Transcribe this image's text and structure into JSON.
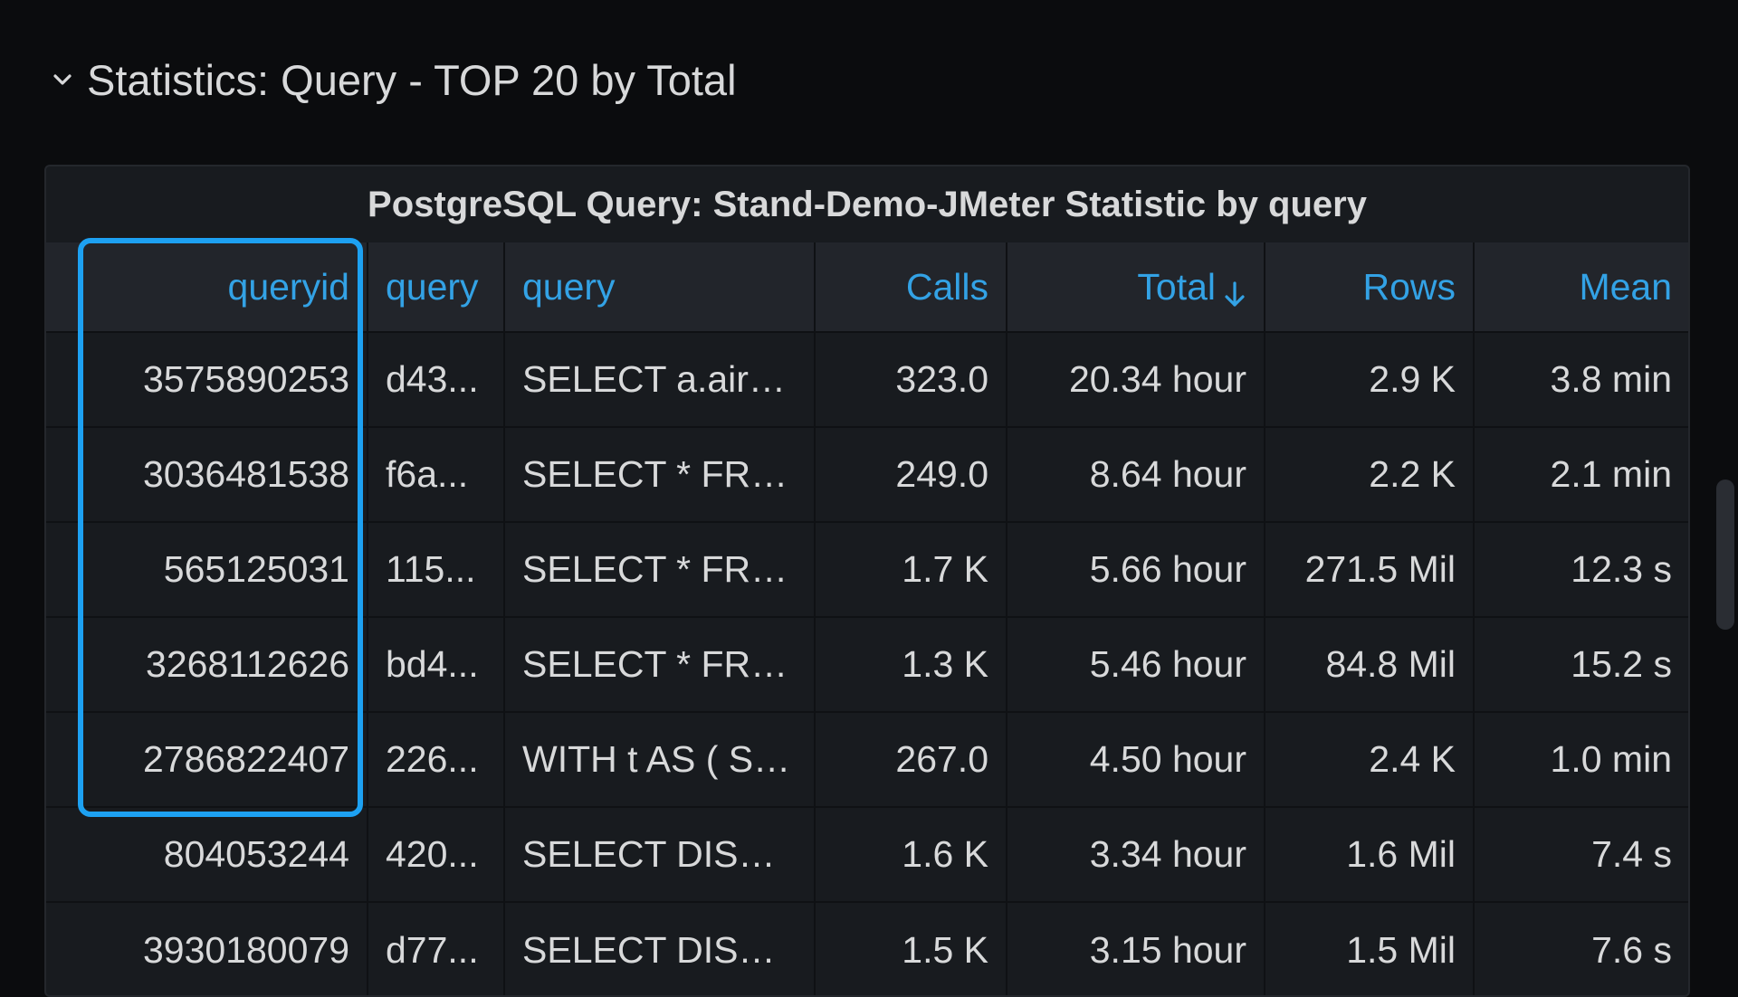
{
  "row": {
    "title": "Statistics: Query - TOP 20 by Total",
    "icon": "chevron-down-icon"
  },
  "panel": {
    "title": "PostgreSQL Query: Stand-Demo-JMeter Statistic by query"
  },
  "table": {
    "columns": [
      "queryid",
      "query",
      "query",
      "Calls",
      "Total",
      "Rows",
      "Mean"
    ],
    "sorted_column": "Total",
    "sort_direction": "descending",
    "rows": [
      {
        "queryid": "3575890253",
        "query_hash": "d43...",
        "query": "SELECT a.aircr...",
        "calls": "323.0",
        "total": "20.34 hour",
        "rows": "2.9 K",
        "mean": "3.8 min"
      },
      {
        "queryid": "3036481538",
        "query_hash": "f6a...",
        "query": "SELECT * FRO...",
        "calls": "249.0",
        "total": "8.64 hour",
        "rows": "2.2 K",
        "mean": "2.1 min"
      },
      {
        "queryid": "565125031",
        "query_hash": "115...",
        "query": "SELECT * FRO...",
        "calls": "1.7 K",
        "total": "5.66 hour",
        "rows": "271.5 Mil",
        "mean": "12.3 s"
      },
      {
        "queryid": "3268112626",
        "query_hash": "bd4...",
        "query": "SELECT * FRO...",
        "calls": "1.3 K",
        "total": "5.46 hour",
        "rows": "84.8 Mil",
        "mean": "15.2 s"
      },
      {
        "queryid": "2786822407",
        "query_hash": "226...",
        "query": "WITH t AS ( SE...",
        "calls": "267.0",
        "total": "4.50 hour",
        "rows": "2.4 K",
        "mean": "1.0 min"
      },
      {
        "queryid": "804053244",
        "query_hash": "420...",
        "query": "SELECT DISTI...",
        "calls": "1.6 K",
        "total": "3.34 hour",
        "rows": "1.6 Mil",
        "mean": "7.4 s"
      },
      {
        "queryid": "3930180079",
        "query_hash": "d77...",
        "query": "SELECT DISTI...",
        "calls": "1.5 K",
        "total": "3.15 hour",
        "rows": "1.5 Mil",
        "mean": "7.6 s"
      }
    ]
  },
  "colors": {
    "background": "#0b0c0e",
    "panel": "#181b1f",
    "header_text": "#33a2e5",
    "query_text": "#73bf69",
    "highlight": "#1da1f2"
  }
}
